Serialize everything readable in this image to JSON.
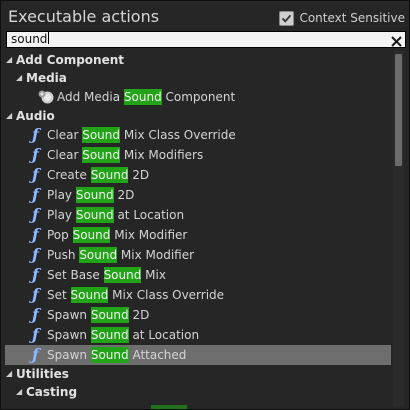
{
  "window": {
    "title": "Executable actions",
    "context_sensitive_label": "Context Sensitive",
    "context_sensitive_checked": true
  },
  "search": {
    "value": "sound"
  },
  "icons": {
    "checkbox": "checkmark-icon",
    "clear": "clear-search-icon",
    "function": "function-icon",
    "media": "media-sound-component-icon",
    "expand": "expanded-triangle-icon"
  },
  "colors": {
    "highlight": "#22a318",
    "selected_row": "#6e6e6e",
    "function_icon": "#8fb8ff"
  },
  "tree": {
    "add_component": {
      "label": "Add Component",
      "media": {
        "label": "Media",
        "items": [
          {
            "before": "Add Media ",
            "match": "Sound",
            "after": " Component"
          }
        ]
      }
    },
    "audio": {
      "label": "Audio",
      "items": [
        {
          "before": "Clear ",
          "match": "Sound",
          "after": " Mix Class Override"
        },
        {
          "before": "Clear ",
          "match": "Sound",
          "after": " Mix Modifiers"
        },
        {
          "before": "Create ",
          "match": "Sound",
          "after": " 2D"
        },
        {
          "before": "Play ",
          "match": "Sound",
          "after": " 2D"
        },
        {
          "before": "Play ",
          "match": "Sound",
          "after": " at Location"
        },
        {
          "before": "Pop ",
          "match": "Sound",
          "after": " Mix Modifier"
        },
        {
          "before": "Push ",
          "match": "Sound",
          "after": " Mix Modifier"
        },
        {
          "before": "Set Base ",
          "match": "Sound",
          "after": " Mix"
        },
        {
          "before": "Set ",
          "match": "Sound",
          "after": " Mix Class Override"
        },
        {
          "before": "Spawn ",
          "match": "Sound",
          "after": " 2D"
        },
        {
          "before": "Spawn ",
          "match": "Sound",
          "after": " at Location"
        },
        {
          "before": "Spawn ",
          "match": "Sound",
          "after": " Attached"
        }
      ],
      "selected_index": 11
    },
    "utilities": {
      "label": "Utilities",
      "casting": {
        "label": "Casting"
      }
    }
  }
}
